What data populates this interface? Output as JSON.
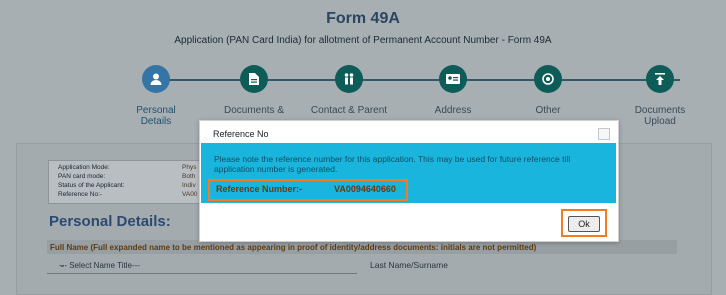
{
  "header": {
    "title": "Form 49A",
    "subtitle": "Application (PAN Card India) for allotment of Permanent Account Number - Form 49A"
  },
  "steps": [
    {
      "line1": "Personal",
      "line2": "Details",
      "icon": "user-icon",
      "active": true
    },
    {
      "line1": "Documents &",
      "line2": "",
      "icon": "document-icon",
      "active": false
    },
    {
      "line1": "Contact & Parent",
      "line2": "",
      "icon": "parents-icon",
      "active": false
    },
    {
      "line1": "Address",
      "line2": "",
      "icon": "id-card-icon",
      "active": false
    },
    {
      "line1": "Other",
      "line2": "",
      "icon": "gear-icon",
      "active": false
    },
    {
      "line1": "Documents",
      "line2": "Upload",
      "icon": "upload-icon",
      "active": false
    }
  ],
  "info": {
    "application_mode_label": "Application Mode:",
    "application_mode_value": "Phys",
    "pan_card_mode_label": "PAN card mode:",
    "pan_card_mode_value": "Both",
    "status_label": "Status of the Applicant:",
    "status_value": "Indiv",
    "reference_label": "Reference No:-",
    "reference_value": "VA00"
  },
  "personal": {
    "heading": "Personal Details:",
    "full_name_note": "Full Name (Full expanded name to be mentioned as appearing in proof of identity/address documents: initials are not permitted)",
    "name_title_select": "--- Select Name Title---",
    "last_name_label": "Last Name/Surname"
  },
  "modal": {
    "title": "Reference No",
    "message": "Please note the reference number for this application. This may be used for future reference till application number is generated.",
    "reference_label": "Reference Number:-",
    "reference_value": "VA0094640660",
    "ok_label": "Ok"
  },
  "colors": {
    "accent_highlight": "#f47c1f",
    "modal_info_bg": "#1ab5dc",
    "step_circle": "#0d5c58",
    "active_step_circle": "#3575a6"
  }
}
